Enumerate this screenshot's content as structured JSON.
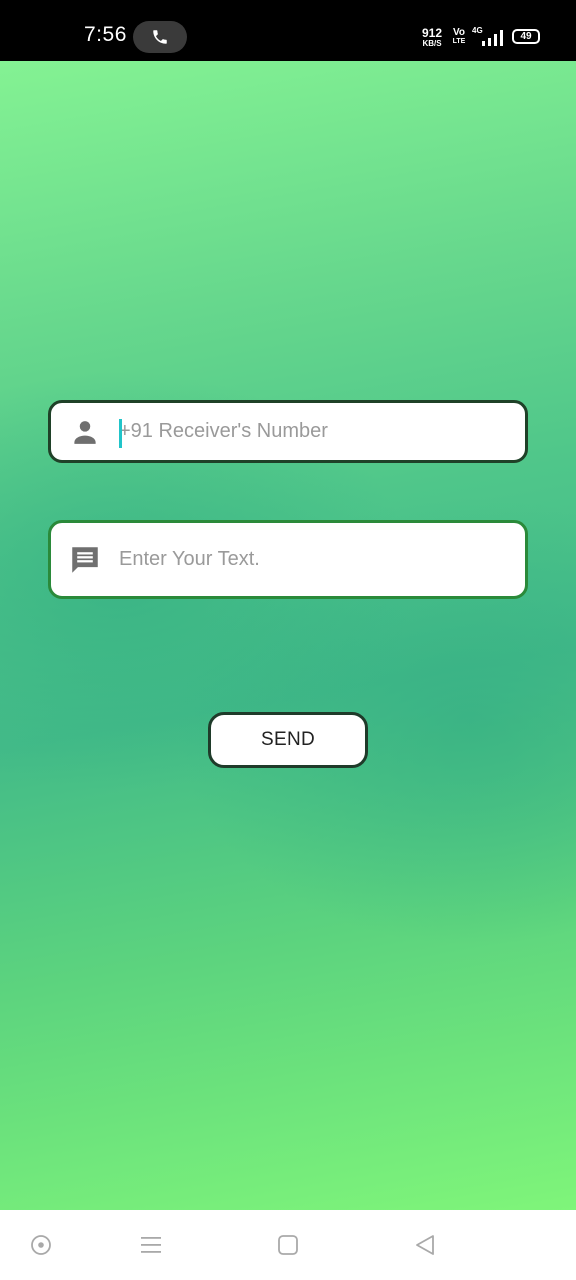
{
  "status_bar": {
    "time": "7:56",
    "net_speed": "912",
    "net_speed_unit": "KB/S",
    "volte_top": "Vo",
    "volte_bottom": "LTE",
    "network_type": "4G",
    "battery": "49"
  },
  "form": {
    "phone_placeholder": "+91 Receiver's Number",
    "message_placeholder": "Enter Your Text.",
    "send_label": "SEND"
  },
  "colors": {
    "accent_caret": "#21c4c9",
    "background_top": "#84f293",
    "background_mid": "#43bb88",
    "background_bottom": "#7ff57a"
  },
  "icons": {
    "phone_field": "person-icon",
    "message_field": "message-icon",
    "call_chip": "phone-icon"
  },
  "nav_bar": {
    "items": [
      "assistant-icon",
      "menu-icon",
      "home-icon",
      "back-icon"
    ]
  }
}
